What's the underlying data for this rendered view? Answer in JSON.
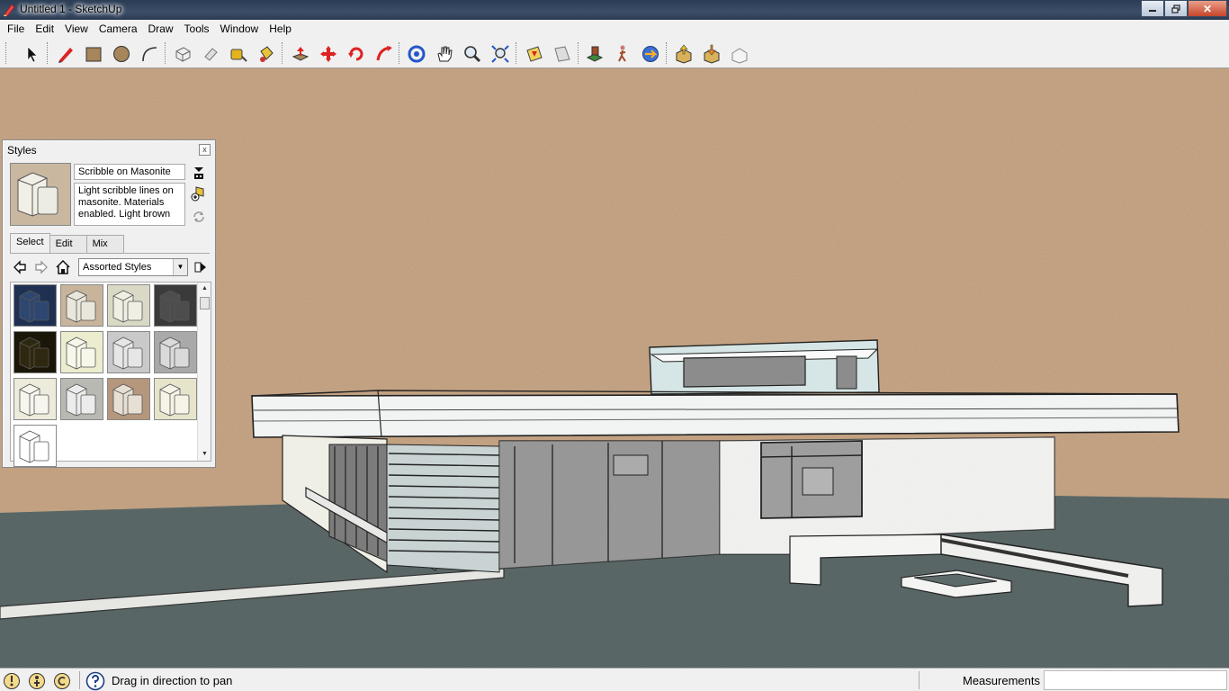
{
  "window": {
    "title": "Untitled 1 - SketchUp",
    "controls": [
      "minimize",
      "maximize",
      "close"
    ],
    "close_glyph": "✕"
  },
  "menu": [
    "File",
    "Edit",
    "View",
    "Camera",
    "Draw",
    "Tools",
    "Window",
    "Help"
  ],
  "toolbar": {
    "tools": [
      "select-icon",
      "pencil-icon",
      "rectangle-icon",
      "circle-icon",
      "arc-icon",
      "make-component-icon",
      "eraser-icon",
      "tape-measure-icon",
      "paint-bucket-icon",
      "push-pull-icon",
      "move-icon",
      "rotate-icon",
      "follow-me-icon",
      "orbit-icon",
      "pan-icon",
      "zoom-icon",
      "zoom-extents-icon",
      "section-plane-icon",
      "dimension-icon",
      "position-camera-icon",
      "walk-icon",
      "look-around-icon",
      "get-models-icon",
      "share-model-icon",
      "photo-textures-icon"
    ]
  },
  "styles_panel": {
    "title": "Styles",
    "close_glyph": "x",
    "style_name": "Scribble on Masonite",
    "style_description": "Light scribble lines on masonite.  Materials enabled. Light brown",
    "tabs": [
      "Select",
      "Edit",
      "Mix"
    ],
    "active_tab": "Select",
    "collection": "Assorted Styles",
    "thumbnails": [
      {
        "bg": "#1f3152",
        "fg": "#2e4770"
      },
      {
        "bg": "#c7b49a",
        "fg": "#e9e6dc"
      },
      {
        "bg": "#d9d9c6",
        "fg": "#efefe3"
      },
      {
        "bg": "#3a3a3a",
        "fg": "#4d4d4d"
      },
      {
        "bg": "#1a1608",
        "fg": "#2f2810"
      },
      {
        "bg": "#ececcf",
        "fg": "#f7f7ea"
      },
      {
        "bg": "#c9c9c9",
        "fg": "#e6e6e6"
      },
      {
        "bg": "#a9a9a9",
        "fg": "#dadada"
      },
      {
        "bg": "#ecebdc",
        "fg": "#f7f6ee"
      },
      {
        "bg": "#b9b9b4",
        "fg": "#ececec"
      },
      {
        "bg": "#b4977c",
        "fg": "#e7dfd3"
      },
      {
        "bg": "#e7e4cc",
        "fg": "#f6f4e7"
      },
      {
        "bg": "#ffffff",
        "fg": "#ffffff"
      }
    ]
  },
  "status": {
    "hint": "Drag in direction to pan",
    "measurements_label": "Measurements",
    "measurements_value": ""
  },
  "colors": {
    "sky": "#c9a887",
    "ground": "#5d6a6a",
    "wall": "#f4f4f2",
    "roof_edge": "#cfe0df",
    "glass": "#9b9b9b"
  }
}
